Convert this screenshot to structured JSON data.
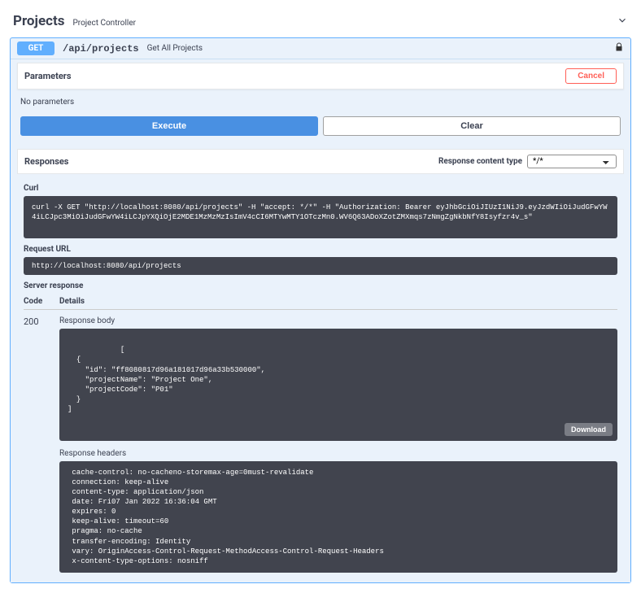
{
  "tag": {
    "name": "Projects",
    "desc": "Project Controller"
  },
  "operation": {
    "method": "GET",
    "path": "/api/projects",
    "summary": "Get All Projects"
  },
  "parameters": {
    "heading": "Parameters",
    "cancel": "Cancel",
    "none": "No parameters",
    "execute": "Execute",
    "clear": "Clear"
  },
  "responses": {
    "heading": "Responses",
    "content_type_label": "Response content type",
    "content_type_value": "*/*"
  },
  "live": {
    "curl_label": "Curl",
    "curl_text": "curl -X GET \"http://localhost:8080/api/projects\" -H \"accept: */*\" -H \"Authorization: Bearer eyJhbGciOiJIUzI1NiJ9.eyJzdWIiOiJudGFwYW4iLCJpc3MiOiJudGFwYW4iLCJpYXQiOjE2MDE1MzMzMzIsImV4cCI6MTYwMTY1OTczMn0.WV6Q63ADoXZotZMXmqs7zNmgZgNkbNfY8Isyfzr4v_s\"",
    "request_url_label": "Request URL",
    "request_url": "http://localhost:8080/api/projects",
    "server_response_label": "Server response",
    "code_col": "Code",
    "details_col": "Details",
    "status": "200",
    "response_body_label": "Response body",
    "response_body": "[\n  {\n    \"id\": \"ff8080817d96a181017d96a33b530000\",\n    \"projectName\": \"Project One\",\n    \"projectCode\": \"P01\"\n  }\n]",
    "download": "Download",
    "response_headers_label": "Response headers",
    "response_headers": " cache-control: no-cacheno-storemax-age=0must-revalidate \n connection: keep-alive \n content-type: application/json \n date: Fri07 Jan 2022 16:36:04 GMT \n expires: 0 \n keep-alive: timeout=60 \n pragma: no-cache \n transfer-encoding: Identity \n vary: OriginAccess-Control-Request-MethodAccess-Control-Request-Headers \n x-content-type-options: nosniff "
  }
}
